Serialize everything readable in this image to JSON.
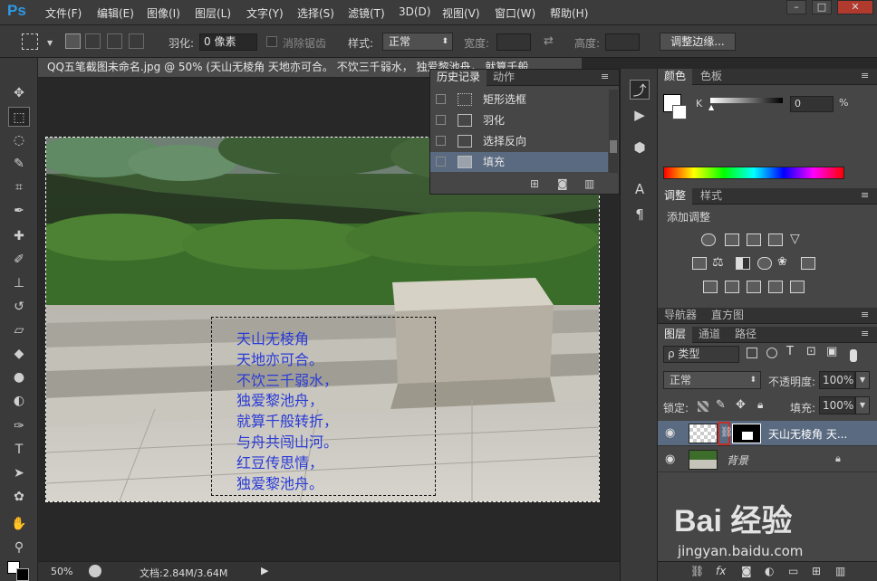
{
  "app": {
    "logo": "Ps"
  },
  "menu": [
    "文件(F)",
    "编辑(E)",
    "图像(I)",
    "图层(L)",
    "文字(Y)",
    "选择(S)",
    "滤镜(T)",
    "3D(D)",
    "视图(V)",
    "窗口(W)",
    "帮助(H)"
  ],
  "window_controls": [
    "–",
    "□",
    "✕"
  ],
  "options": {
    "feather_label": "羽化:",
    "feather_value": "0 像素",
    "antialias_label": "消除锯齿",
    "style_label": "样式:",
    "style_value": "正常",
    "width_label": "宽度:",
    "height_label": "高度:",
    "refine_edge_button": "调整边缘..."
  },
  "document": {
    "tab_title": "QQ五笔截图未命名.jpg @ 50% (天山无棱角 天地亦可合。 不饮三千弱水， 独爱黎池舟， 就算千般",
    "poem_lines": [
      "天山无棱角",
      "天地亦可合。",
      "不饮三千弱水，",
      "独爱黎池舟，",
      "就算千般转折，",
      "与舟共闯山河。",
      "红豆传思情，",
      "独爱黎池舟。"
    ]
  },
  "status": {
    "zoom": "50%",
    "doc_info": "文档:2.84M/3.64M"
  },
  "history_panel": {
    "tabs": [
      "历史记录",
      "动作"
    ],
    "items": [
      {
        "label": "矩形选框"
      },
      {
        "label": "羽化"
      },
      {
        "label": "选择反向"
      },
      {
        "label": "填充"
      }
    ]
  },
  "color_panel": {
    "tabs": [
      "颜色",
      "色板"
    ],
    "channel_label": "K",
    "value": "0",
    "unit": "%"
  },
  "adjust_panel": {
    "tabs": [
      "调整",
      "样式"
    ],
    "heading": "添加调整"
  },
  "nav_panel": {
    "tabs": [
      "导航器",
      "直方图"
    ]
  },
  "layers_panel": {
    "tabs": [
      "图层",
      "通道",
      "路径"
    ],
    "kind_label": "ρ 类型",
    "blend_mode": "正常",
    "opacity_label": "不透明度:",
    "opacity_value": "100%",
    "lock_label": "锁定:",
    "fill_label": "填充:",
    "fill_value": "100%",
    "layers": [
      {
        "name": "天山无棱角 天..."
      },
      {
        "name": "背景"
      }
    ]
  },
  "watermark": {
    "brand": "Bai 经验",
    "url": "jingyan.baidu.com"
  }
}
